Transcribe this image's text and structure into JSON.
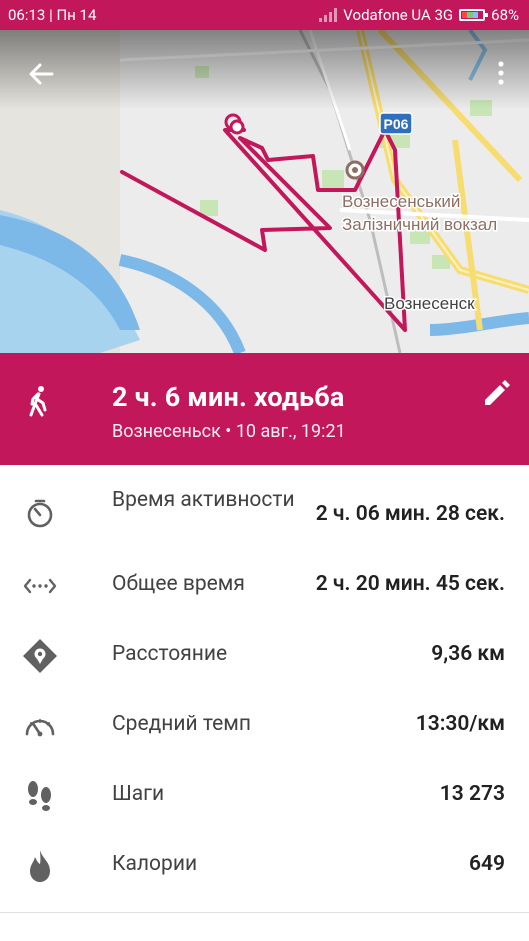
{
  "status_bar": {
    "time_day": "06:13 | Пн 14",
    "carrier": "Vodafone UA 3G",
    "battery": "68%"
  },
  "map": {
    "road_badge": "Р06",
    "station_label_line1": "Вознесенський",
    "station_label_line2": "Залізничний вокзал",
    "city_label": "Вознесенск"
  },
  "summary": {
    "title": "2 ч. 6 мин. ходьба",
    "subtitle": "Вознесеньск • 10 авг., 19:21"
  },
  "stats": [
    {
      "icon": "timer-icon",
      "label": "Время активности",
      "value": "2 ч. 06 мин. 28 сек."
    },
    {
      "icon": "total-time-icon",
      "label": "Общее время",
      "value": "2 ч. 20 мин. 45 сек."
    },
    {
      "icon": "distance-icon",
      "label": "Расстояние",
      "value": "9,36 км"
    },
    {
      "icon": "pace-icon",
      "label": "Средний темп",
      "value": "13:30/км"
    },
    {
      "icon": "steps-icon",
      "label": "Шаги",
      "value": "13 273"
    },
    {
      "icon": "calories-icon",
      "label": "Калории",
      "value": "649"
    }
  ],
  "colors": {
    "accent": "#c2185b",
    "route": "#c2185b",
    "icon_grey": "#616161"
  }
}
